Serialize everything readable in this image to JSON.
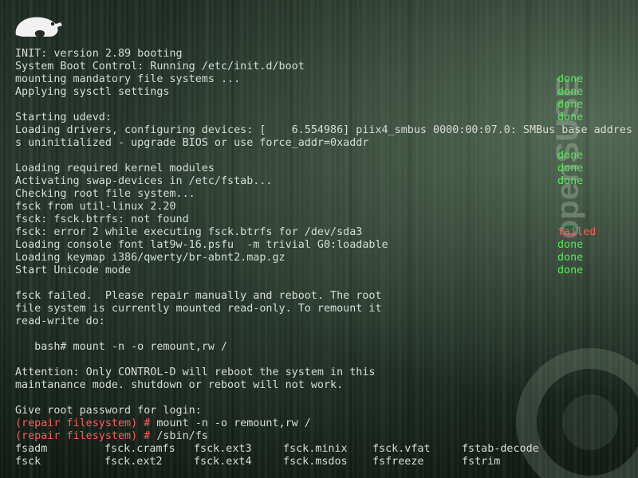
{
  "colors": {
    "text": "#d6dcd6",
    "done": "#5ae85a",
    "failed": "#ff5b5b",
    "prompt": "#ff5b5b"
  },
  "logo": {
    "icon": "opensuse-chameleon-logo"
  },
  "watermark": {
    "text": "openSUSE"
  },
  "console": {
    "lines": [
      {
        "text": "INIT: version 2.89 booting",
        "status": ""
      },
      {
        "text": "System Boot Control: Running /etc/init.d/boot",
        "status": ""
      },
      {
        "text": "mounting mandatory file systems ...",
        "status": "done"
      },
      {
        "text": "Applying sysctl settings",
        "status": "done"
      },
      {
        "text": "",
        "status": "done"
      },
      {
        "text": "Starting udevd:",
        "status": "done"
      },
      {
        "text": "Loading drivers, configuring devices: [    6.554986] piix4_smbus 0000:00:07.0: SMBus base addres",
        "status": ""
      },
      {
        "text": "s uninitialized - upgrade BIOS or use force_addr=0xaddr",
        "status": ""
      },
      {
        "text": "",
        "status": "done"
      },
      {
        "text": "Loading required kernel modules",
        "status": "done"
      },
      {
        "text": "Activating swap-devices in /etc/fstab...",
        "status": "done"
      },
      {
        "text": "Checking root file system...",
        "status": ""
      },
      {
        "text": "fsck from util-linux 2.20",
        "status": ""
      },
      {
        "text": "fsck: fsck.btrfs: not found",
        "status": ""
      },
      {
        "text": "fsck: error 2 while executing fsck.btrfs for /dev/sda3",
        "status": "failed"
      },
      {
        "text": "Loading console font lat9w-16.psfu  -m trivial G0:loadable",
        "status": "done"
      },
      {
        "text": "Loading keymap i386/qwerty/br-abnt2.map.gz",
        "status": "done"
      },
      {
        "text": "Start Unicode mode",
        "status": "done"
      },
      {
        "text": "",
        "status": ""
      },
      {
        "text": "fsck failed.  Please repair manually and reboot. The root",
        "status": ""
      },
      {
        "text": "file system is currently mounted read-only. To remount it",
        "status": ""
      },
      {
        "text": "read-write do:",
        "status": ""
      },
      {
        "text": "",
        "status": ""
      },
      {
        "text": "   bash# mount -n -o remount,rw /",
        "status": ""
      },
      {
        "text": "",
        "status": ""
      },
      {
        "text": "Attention: Only CONTROL-D will reboot the system in this",
        "status": ""
      },
      {
        "text": "maintanance mode. shutdown or reboot will not work.",
        "status": ""
      },
      {
        "text": "",
        "status": ""
      },
      {
        "text": "Give root password for login:",
        "status": ""
      }
    ],
    "prompts": [
      {
        "prompt": "(repair filesystem) #",
        "command": " mount -n -o remount,rw /"
      },
      {
        "prompt": "(repair filesystem) #",
        "command": " /sbin/fs"
      }
    ],
    "ls_output": [
      [
        "fsadm",
        "fsck.cramfs",
        "fsck.ext3",
        "fsck.minix",
        "fsck.vfat",
        "fstab-decode"
      ],
      [
        "fsck",
        "fsck.ext2",
        "fsck.ext4",
        "fsck.msdos",
        "fsfreeze",
        "fstrim"
      ]
    ]
  }
}
